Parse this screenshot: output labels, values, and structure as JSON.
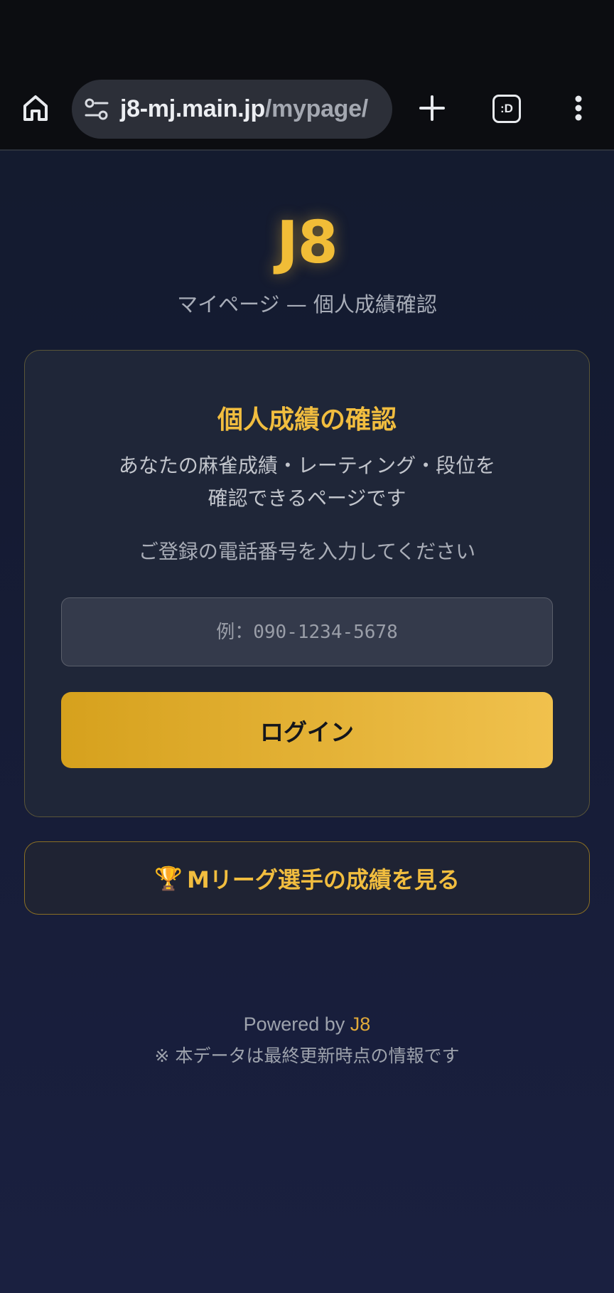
{
  "browser": {
    "url_host": "j8-mj.main.jp",
    "url_path": "/mypage/",
    "tab_switcher_label": ":D"
  },
  "header": {
    "logo": "J8",
    "subtitle": "マイページ — 個人成績確認"
  },
  "card": {
    "title": "個人成績の確認",
    "description_line1": "あなたの麻雀成績・レーティング・段位を",
    "description_line2": "確認できるページです",
    "prompt": "ご登録の電話番号を入力してください",
    "phone_input": {
      "value": "",
      "placeholder": "例：090-1234-5678"
    },
    "login_label": "ログイン"
  },
  "mleague": {
    "icon": "trophy-icon",
    "label": "Mリーグ選手の成績を見る"
  },
  "footer": {
    "powered_prefix": "Powered by",
    "powered_brand": "J8",
    "note": "※ 本データは最終更新時点の情報です"
  },
  "colors": {
    "accent": "#f1bd3f",
    "background": "#151b33",
    "card": "#1f2638",
    "chrome": "#0c0d11"
  }
}
